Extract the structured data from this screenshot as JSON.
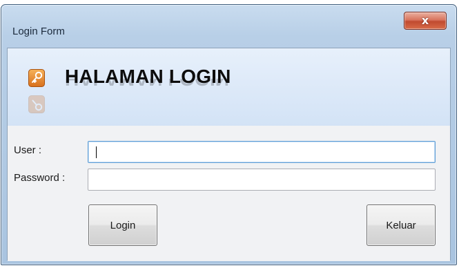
{
  "window": {
    "title": "Login Form",
    "close_label": "x"
  },
  "banner": {
    "title": "HALAMAN LOGIN",
    "icon": "key-icon"
  },
  "form": {
    "user_label": "User :",
    "user_value": "",
    "password_label": "Password :",
    "password_value": ""
  },
  "buttons": {
    "login_label": "Login",
    "exit_label": "Keluar"
  },
  "colors": {
    "frame": "#a9c4e0",
    "close_button": "#c04a30",
    "banner_bg": "#dbe8f8",
    "key_icon": "#e8892b"
  }
}
